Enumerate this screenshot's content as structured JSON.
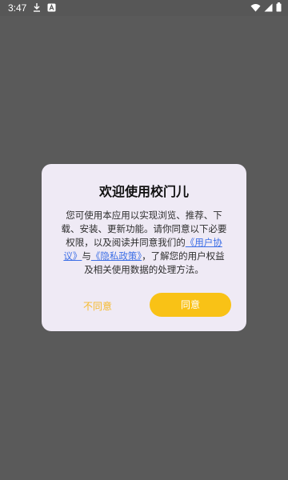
{
  "status_bar": {
    "time": "3:47",
    "icons": [
      "download-icon",
      "notification-a-icon",
      "wifi-icon",
      "signal-icon",
      "battery-icon"
    ]
  },
  "dialog": {
    "title": "欢迎使用校门儿",
    "message_part1": "您可使用本应用以实现浏览、推荐、下载、安装、更新功能。请你同意以下必要权限，以及阅读并同意我们的",
    "user_agreement_link": "《用户协议》",
    "connector": "与",
    "privacy_policy_link": "《隐私政策》",
    "message_part2": "，了解您的用户权益及相关使用数据的处理方法。",
    "disagree_label": "不同意",
    "agree_label": "同意"
  },
  "colors": {
    "overlay": "#5a5a5a",
    "dialog_background": "#efeaf5",
    "accent": "#f9c216",
    "link": "#3d6fe6"
  }
}
